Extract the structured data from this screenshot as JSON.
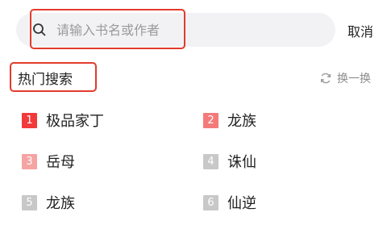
{
  "search": {
    "placeholder": "请输入书名或作者",
    "cancel_label": "取消"
  },
  "hot": {
    "title": "热门搜索",
    "refresh_label": "换一换",
    "items": [
      {
        "rank": "1",
        "label": "极品家丁",
        "color": "#f23a3a"
      },
      {
        "rank": "2",
        "label": "龙族",
        "color": "#f47a7a"
      },
      {
        "rank": "3",
        "label": "岳母",
        "color": "#f6a3a3"
      },
      {
        "rank": "4",
        "label": "诛仙",
        "color": "#c8c8c8"
      },
      {
        "rank": "5",
        "label": "龙族",
        "color": "#c8c8c8"
      },
      {
        "rank": "6",
        "label": "仙逆",
        "color": "#c8c8c8"
      }
    ]
  },
  "colors": {
    "highlight_border": "#e23b2c",
    "search_bg": "#f2f2f4"
  }
}
